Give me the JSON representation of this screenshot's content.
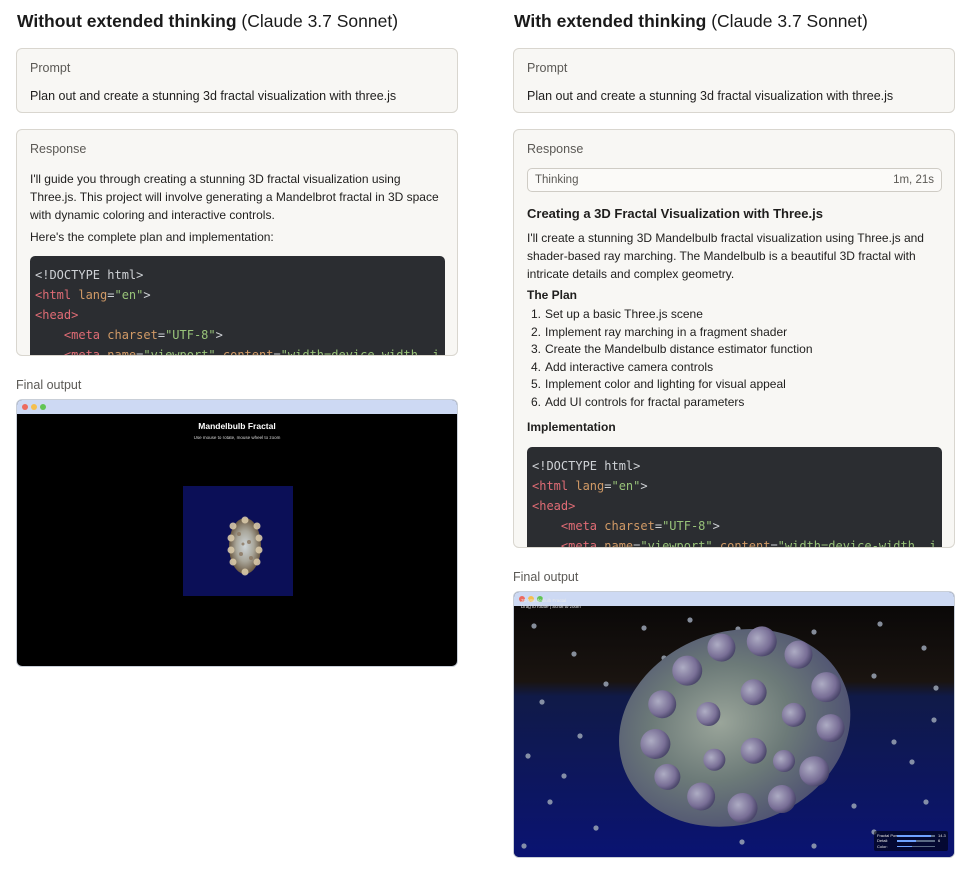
{
  "left": {
    "heading_bold": "Without extended thinking",
    "heading_model": "(Claude 3.7 Sonnet)",
    "prompt": {
      "label": "Prompt",
      "text": "Plan out and create a stunning 3d fractal visualization with three.js"
    },
    "response": {
      "label": "Response",
      "para1": "I'll guide you through creating a stunning 3D fractal visualization using Three.js. This project will involve generating a Mandelbrot fractal in 3D space with dynamic coloring and interactive controls.",
      "para2": "Here's the complete plan and implementation:"
    },
    "final_output_label": "Final output",
    "output": {
      "title": "Mandelbulb Fractal",
      "subtitle": "Use mouse to rotate, mouse wheel to zoom"
    }
  },
  "right": {
    "heading_bold": "With extended thinking",
    "heading_model": "(Claude 3.7 Sonnet)",
    "prompt": {
      "label": "Prompt",
      "text": "Plan out and create a stunning 3d fractal visualization with three.js"
    },
    "response": {
      "label": "Response",
      "thinking_label": "Thinking",
      "thinking_time": "1m, 21s",
      "heading": "Creating a 3D Fractal Visualization with Three.js",
      "intro": "I'll create a stunning 3D Mandelbulb fractal visualization using Three.js and shader-based ray marching. The Mandelbulb is a beautiful 3D fractal with intricate details and complex geometry.",
      "plan_heading": "The Plan",
      "plan": [
        "Set up a basic Three.js scene",
        "Implement ray marching in a fragment shader",
        "Create the Mandelbulb distance estimator function",
        "Add interactive camera controls",
        "Implement color and lighting for visual appeal",
        "Add UI controls for fractal parameters"
      ],
      "impl_heading": "Implementation"
    },
    "final_output_label": "Final output",
    "output": {
      "info_line1": "3D Mandelbulb Fractal",
      "info_line2": "Drag to rotate | Scroll to zoom",
      "controls": [
        {
          "label": "Fractal Power:",
          "value": "14.3",
          "level": 0.9
        },
        {
          "label": "Detail:",
          "value": "6",
          "level": 0.5
        },
        {
          "label": "Color:",
          "value": "",
          "level": 0.4
        }
      ]
    }
  },
  "code_lines": [
    [
      [
        "plain",
        "<!DOCTYPE html>"
      ]
    ],
    [
      [
        "tag",
        "<html"
      ],
      [
        "attr",
        " lang"
      ],
      [
        "plain",
        "="
      ],
      [
        "str",
        "\"en\""
      ],
      [
        "plain",
        ">"
      ]
    ],
    [
      [
        "tag",
        "<head>"
      ]
    ],
    [
      [
        "plain",
        "    "
      ],
      [
        "tag",
        "<meta"
      ],
      [
        "attr",
        " charset"
      ],
      [
        "plain",
        "="
      ],
      [
        "str",
        "\"UTF-8\""
      ],
      [
        "plain",
        ">"
      ]
    ],
    [
      [
        "plain",
        "    "
      ],
      [
        "tag",
        "<meta"
      ],
      [
        "attr",
        " name"
      ],
      [
        "plain",
        "="
      ],
      [
        "str",
        "\"viewport\""
      ],
      [
        "attr",
        " content"
      ],
      [
        "plain",
        "="
      ],
      [
        "str",
        "\"width=device-width, i"
      ]
    ]
  ]
}
